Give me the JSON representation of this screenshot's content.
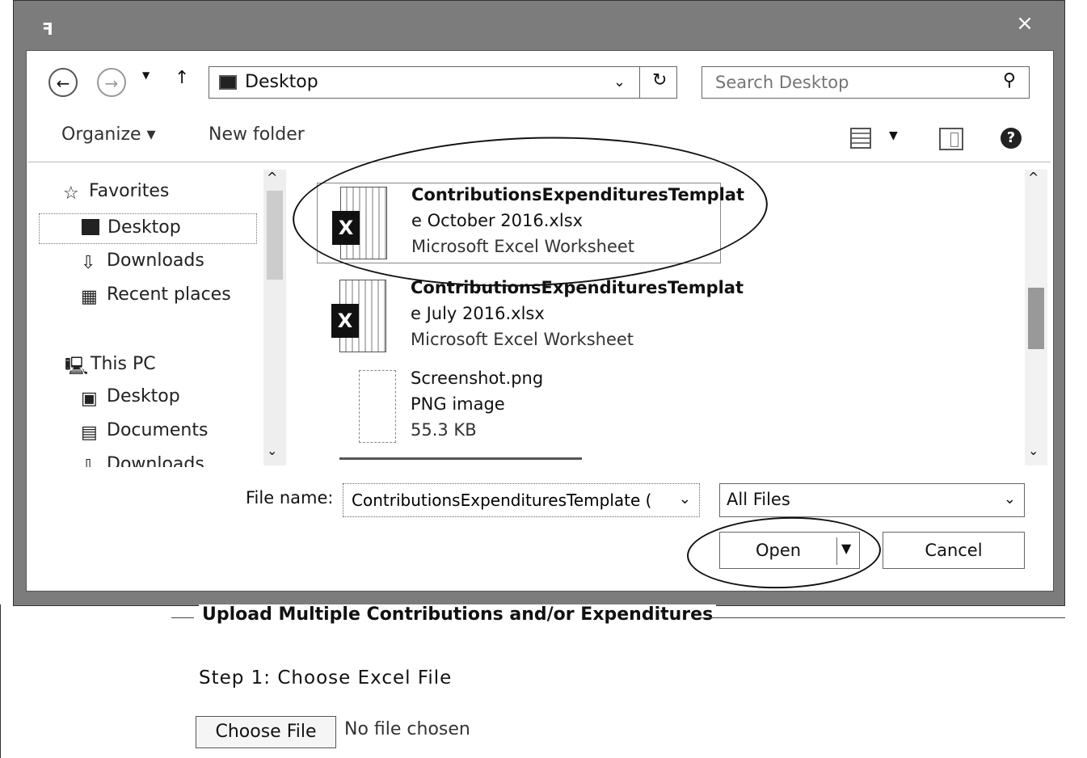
{
  "dialog": {
    "close_glyph": "×",
    "address": {
      "path": "Desktop",
      "icon": "folder-icon"
    },
    "search": {
      "placeholder": "Search Desktop"
    },
    "toolbar": {
      "organize": "Organize ▾",
      "new_folder": "New folder"
    },
    "nav": {
      "favorites": "Favorites",
      "desktop": "Desktop",
      "downloads": "Downloads",
      "recent": "Recent places",
      "this_pc": "This PC",
      "desktop2": "Desktop",
      "documents": "Documents",
      "downloads2": "Downloads"
    },
    "files": [
      {
        "line1": "ContributionsExpendituresTemplat",
        "line2": "e October 2016.xlsx",
        "line3": "Microsoft Excel Worksheet"
      },
      {
        "line1": "ContributionsExpendituresTemplat",
        "line2": "e July 2016.xlsx",
        "line3": "Microsoft Excel Worksheet"
      },
      {
        "line1": "Screenshot.png",
        "line2": "PNG image",
        "line3": "55.3 KB"
      }
    ],
    "file_name_label": "File name:",
    "file_name_value": "ContributionsExpendituresTemplate (",
    "file_type": "All Files",
    "open_label": "Open",
    "cancel_label": "Cancel"
  },
  "page": {
    "section_title": "Upload Multiple Contributions and/or Expenditures",
    "step1": "Step 1: Choose Excel File",
    "choose_file": "Choose File",
    "no_file": "No file chosen"
  }
}
